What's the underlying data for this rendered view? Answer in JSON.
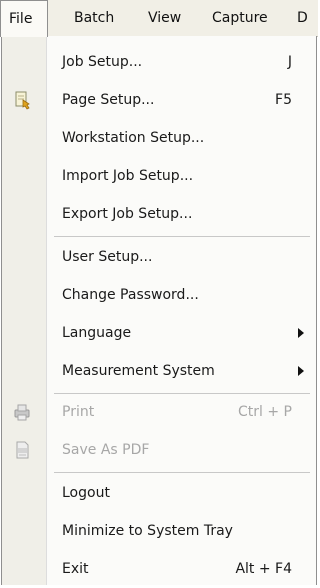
{
  "menubar": {
    "items": [
      {
        "label": "File"
      },
      {
        "label": "Batch"
      },
      {
        "label": "View"
      },
      {
        "label": "Capture"
      },
      {
        "label": "D"
      }
    ]
  },
  "file_menu": {
    "items": [
      {
        "label": "Job Setup...",
        "shortcut": "J"
      },
      {
        "label": "Page Setup...",
        "shortcut": "F5",
        "icon": "page-setup-icon"
      },
      {
        "label": "Workstation Setup..."
      },
      {
        "label": "Import Job Setup..."
      },
      {
        "label": "Export Job Setup..."
      },
      {
        "label": "User Setup..."
      },
      {
        "label": "Change Password..."
      },
      {
        "label": "Language",
        "submenu": true
      },
      {
        "label": "Measurement System",
        "submenu": true
      },
      {
        "label": "Print",
        "shortcut": "Ctrl + P",
        "disabled": true,
        "icon": "printer-icon"
      },
      {
        "label": "Save As PDF",
        "disabled": true,
        "icon": "pdf-icon"
      },
      {
        "label": "Logout"
      },
      {
        "label": "Minimize to System Tray"
      },
      {
        "label": "Exit",
        "shortcut": "Alt + F4"
      }
    ]
  }
}
